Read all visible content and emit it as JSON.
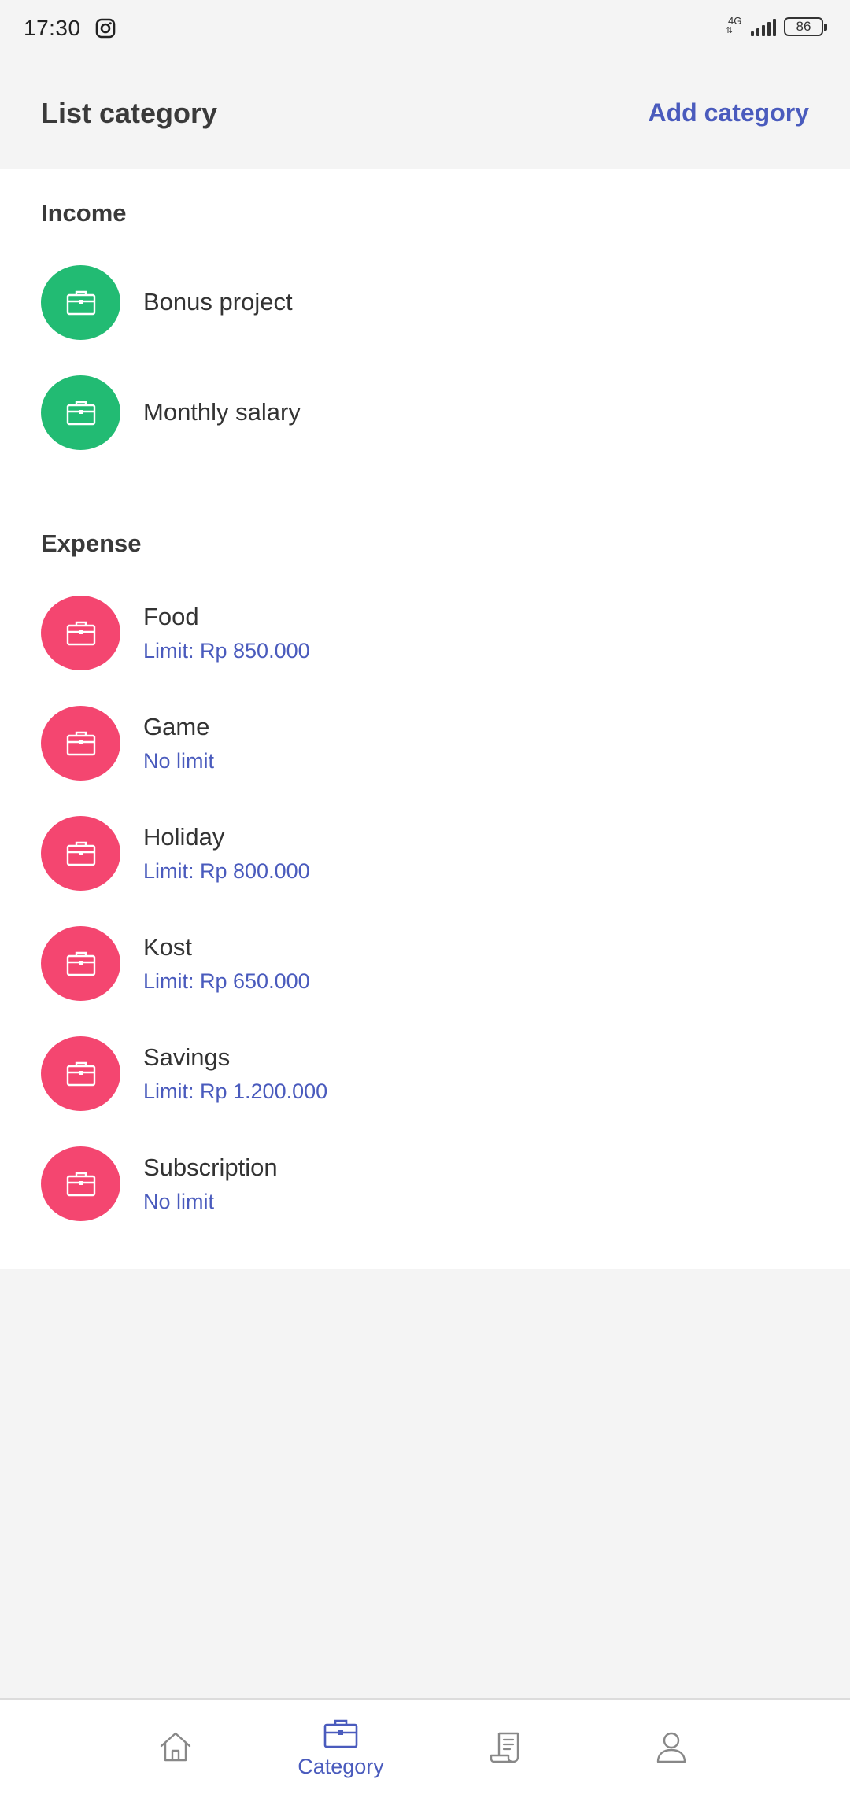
{
  "status_bar": {
    "time": "17:30",
    "network": "4G",
    "battery": "86"
  },
  "header": {
    "title": "List category",
    "add_label": "Add category"
  },
  "colors": {
    "accent": "#4a5bbd",
    "income": "#22bb73",
    "expense": "#f44670"
  },
  "sections": {
    "income": {
      "title": "Income",
      "items": [
        {
          "name": "Bonus project",
          "icon": "briefcase-icon"
        },
        {
          "name": "Monthly salary",
          "icon": "briefcase-icon"
        }
      ]
    },
    "expense": {
      "title": "Expense",
      "items": [
        {
          "name": "Food",
          "limit": "Limit: Rp 850.000",
          "icon": "briefcase-icon"
        },
        {
          "name": "Game",
          "limit": "No limit",
          "icon": "briefcase-icon"
        },
        {
          "name": "Holiday",
          "limit": "Limit: Rp 800.000",
          "icon": "briefcase-icon"
        },
        {
          "name": "Kost",
          "limit": "Limit: Rp 650.000",
          "icon": "briefcase-icon"
        },
        {
          "name": "Savings",
          "limit": "Limit: Rp 1.200.000",
          "icon": "briefcase-icon"
        },
        {
          "name": "Subscription",
          "limit": "No limit",
          "icon": "briefcase-icon"
        }
      ]
    }
  },
  "bottom_nav": {
    "items": [
      {
        "icon": "home-icon",
        "label": ""
      },
      {
        "icon": "briefcase-icon",
        "label": "Category",
        "active": true
      },
      {
        "icon": "receipt-icon",
        "label": ""
      },
      {
        "icon": "profile-icon",
        "label": ""
      }
    ]
  }
}
